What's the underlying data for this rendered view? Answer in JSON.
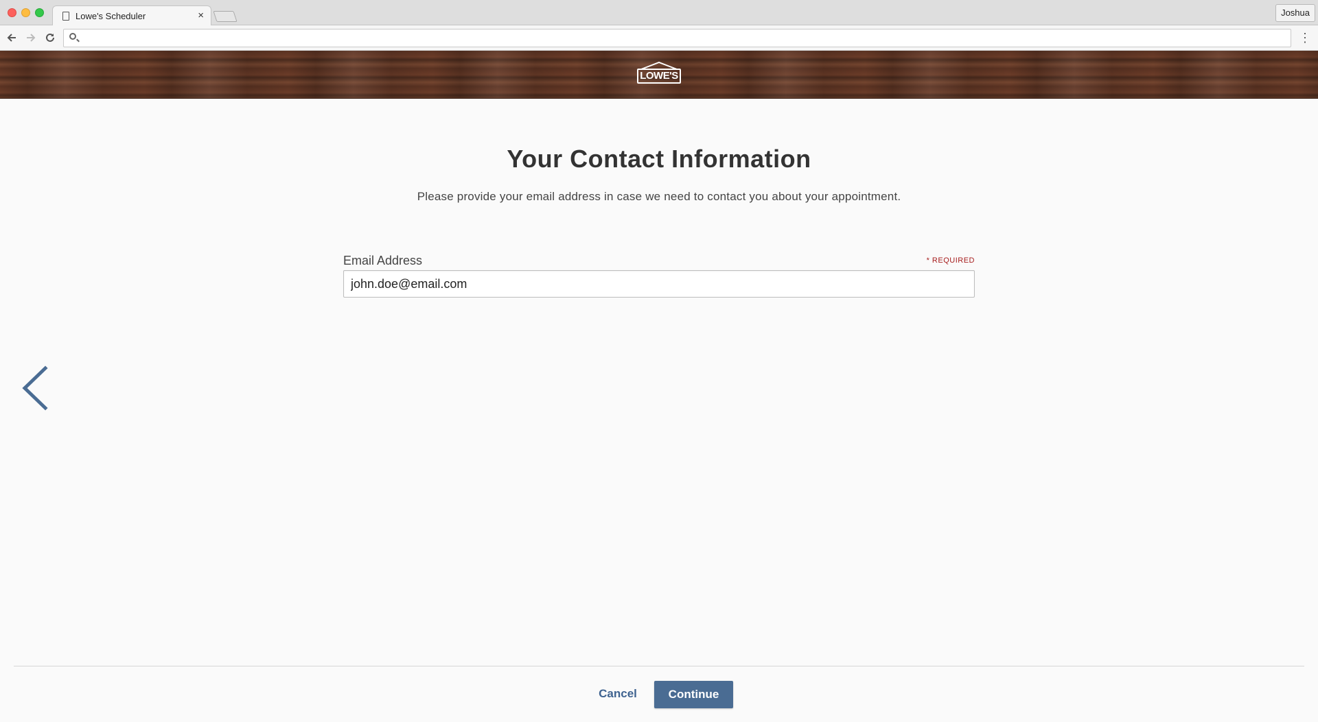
{
  "browser": {
    "tab_title": "Lowe's Scheduler",
    "tab_close": "×",
    "profile_name": "Joshua",
    "address_value": ""
  },
  "header": {
    "logo_text": "LOWE'S"
  },
  "main": {
    "title": "Your Contact Information",
    "subtitle": "Please provide your email address in case we need to contact you about your appointment.",
    "email": {
      "label": "Email Address",
      "required_text": "* REQUIRED",
      "value": "john.doe@email.com"
    }
  },
  "footer": {
    "cancel_label": "Cancel",
    "continue_label": "Continue"
  },
  "colors": {
    "accent": "#4a6c93",
    "link": "#3f6390",
    "required": "#a61c1c"
  }
}
